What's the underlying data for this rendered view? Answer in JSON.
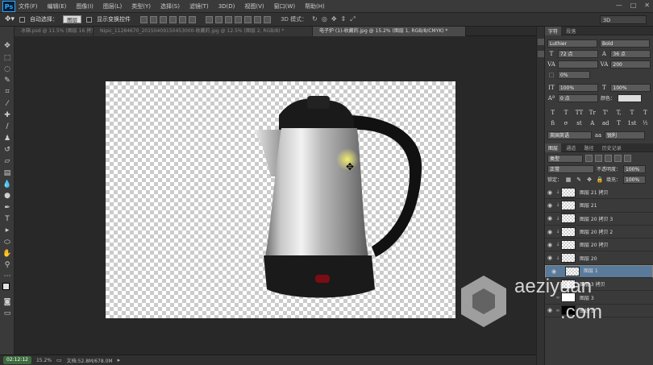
{
  "app": {
    "logo": "Ps"
  },
  "menu": [
    "文件(F)",
    "编辑(E)",
    "图像(I)",
    "图层(L)",
    "类型(Y)",
    "选择(S)",
    "滤镜(T)",
    "3D(D)",
    "视图(V)",
    "窗口(W)",
    "帮助(H)"
  ],
  "options": {
    "auto_select_label": "自动选择：",
    "auto_select_value": "图层",
    "show_transform_label": "显示变换控件",
    "mode_3d_label": "3D 模式：",
    "workspace": "3D"
  },
  "tabs": [
    {
      "label": "冰箱.psd @ 11.5% (图层 16 拷贝, RGB/8) *",
      "active": false
    },
    {
      "label": "Nipic_11284670_20150409150453000-收藏的.jpg @ 12.5% (图层 2, RGB/8) *",
      "active": false
    },
    {
      "label": "电子炉 (1)-收藏的.jpg @ 15.2% (图层 1, RGB/8/CMYK) *",
      "active": true
    }
  ],
  "status": {
    "time": "02:12:12",
    "zoom": "15.2%",
    "doc_info": "文档:52.8M/678.0M"
  },
  "character_panel": {
    "tabs": [
      "字符",
      "段落"
    ],
    "font_family": "Luthier",
    "font_style": "Bold",
    "font_size": "72 点",
    "leading": "36 点",
    "kerning_label": "VA",
    "tracking": "200",
    "scale_pct": "0%",
    "vscale": "100%",
    "hscale": "100%",
    "baseline": "0 点",
    "color_label": "颜色：",
    "language": "英国英语",
    "aa_label": "aa",
    "antialias": "锐利",
    "style_buttons": [
      "T",
      "T",
      "TT",
      "Tr",
      "T'",
      "T,",
      "T",
      "T"
    ]
  },
  "layers_panel": {
    "tabs": [
      "图层",
      "通道",
      "路径",
      "历史记录"
    ],
    "filter": "类型",
    "blend_mode": "正常",
    "opacity_label": "不透明度：",
    "opacity": "100%",
    "lock_label": "锁定：",
    "fill_label": "填充：",
    "fill": "100%",
    "layers": [
      {
        "name": "图层 21 拷贝",
        "selected": false
      },
      {
        "name": "图层 21",
        "selected": false
      },
      {
        "name": "图层 20 拷贝 3",
        "selected": false
      },
      {
        "name": "图层 20 拷贝 2",
        "selected": false
      },
      {
        "name": "图层 20 拷贝",
        "selected": false
      },
      {
        "name": "图层 20",
        "selected": false
      },
      {
        "name": "图层 1",
        "selected": true
      },
      {
        "name": "图层 3 拷贝",
        "selected": false
      },
      {
        "name": "图层 3",
        "selected": false
      },
      {
        "name": "曲线 1",
        "selected": false
      }
    ]
  },
  "watermark": {
    "line1": "aeziyuan",
    "line2": ".com"
  }
}
